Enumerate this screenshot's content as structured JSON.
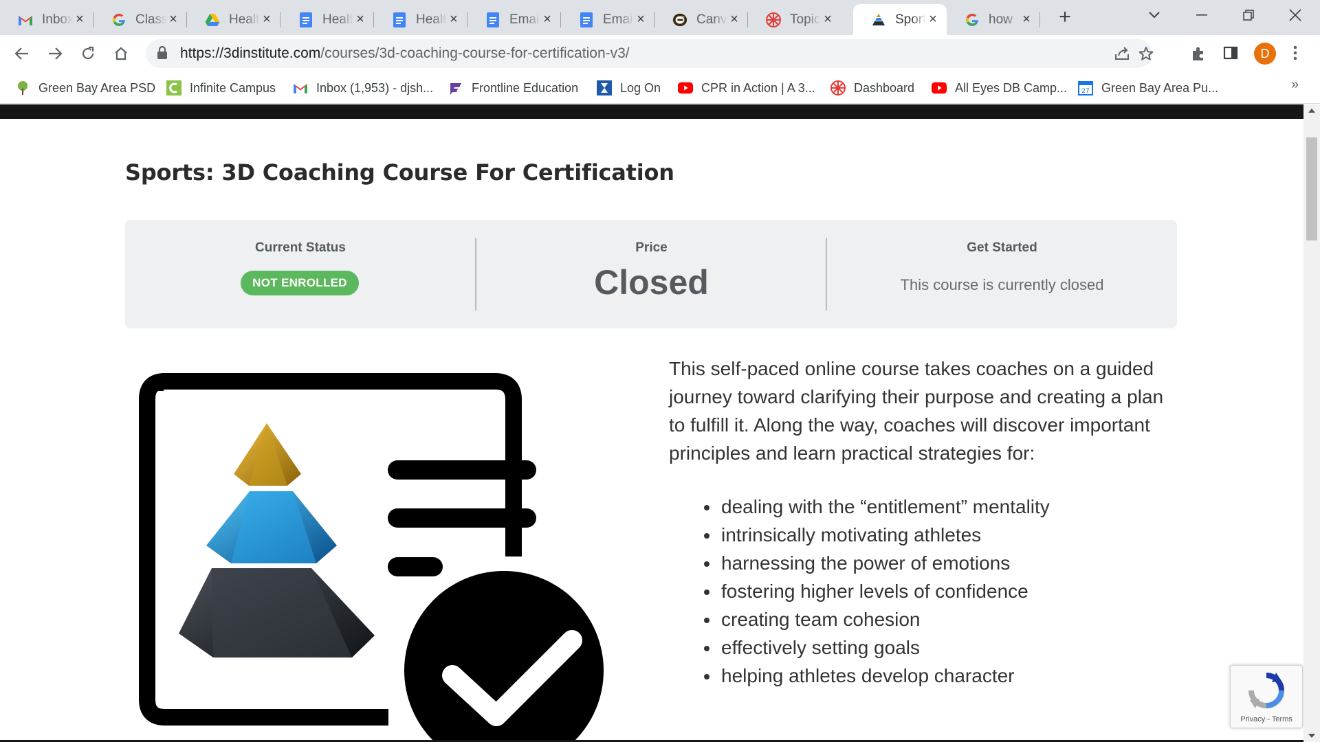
{
  "browser": {
    "tabs": [
      {
        "title": "Inbox",
        "icon": "gmail-icon",
        "active": false
      },
      {
        "title": "Class",
        "icon": "google-icon",
        "active": false
      },
      {
        "title": "Healt",
        "icon": "google-drive-icon",
        "active": false
      },
      {
        "title": "Healt",
        "icon": "google-docs-icon",
        "active": false
      },
      {
        "title": "Healt",
        "icon": "google-docs-icon",
        "active": false
      },
      {
        "title": "Emai",
        "icon": "google-docs-icon",
        "active": false
      },
      {
        "title": "Emai",
        "icon": "google-docs-icon",
        "active": false
      },
      {
        "title": "Canv",
        "icon": "canvas-e-icon",
        "active": false
      },
      {
        "title": "Topic",
        "icon": "topic-wheel-icon",
        "active": false
      },
      {
        "title": "Sport",
        "icon": "pyramid-icon",
        "active": true
      },
      {
        "title": "how",
        "icon": "google-icon",
        "active": false
      }
    ],
    "new_tab_label": "+",
    "url_host": "https://3dinstitute.com",
    "url_path": "/courses/3d-coaching-course-for-certification-v3/",
    "profile_initial": "D",
    "accent_color": "#e8710a",
    "bookmarks": [
      {
        "label": "Green Bay Area PSD",
        "icon": "tree-icon"
      },
      {
        "label": "Infinite Campus",
        "icon": "infinite-campus-icon"
      },
      {
        "label": "Inbox (1,953) - djsh...",
        "icon": "gmail-icon"
      },
      {
        "label": "Frontline Education",
        "icon": "frontline-icon"
      },
      {
        "label": "Log On",
        "icon": "hourglass-icon"
      },
      {
        "label": "CPR in Action | A 3...",
        "icon": "youtube-icon"
      },
      {
        "label": "Dashboard",
        "icon": "topic-wheel-icon"
      },
      {
        "label": "All Eyes DB Camp...",
        "icon": "youtube-icon"
      },
      {
        "label": "Green Bay Area Pu...",
        "icon": "calendar-icon"
      }
    ],
    "bookmarks_more": "»"
  },
  "page": {
    "course_title": "Sports: 3D Coaching Course For Certification",
    "status": {
      "current_status_label": "Current Status",
      "status_badge": "NOT ENROLLED",
      "badge_color": "#5cb85c",
      "price_label": "Price",
      "price_value": "Closed",
      "get_started_label": "Get Started",
      "get_started_msg": "This course is currently closed"
    },
    "description": "This self-paced online course takes coaches on a guided journey toward clarifying their purpose and creating a plan to fulfill it. Along the way, coaches will discover important principles and learn practical strategies for:",
    "bullets": [
      "dealing with the “entitlement” mentality",
      "intrinsically motivating athletes",
      "harnessing the power of emotions",
      "fostering higher levels of confidence",
      "creating team cohesion",
      "effectively setting goals",
      "helping athletes develop character"
    ],
    "recaptcha_text": "Privacy - Terms"
  }
}
